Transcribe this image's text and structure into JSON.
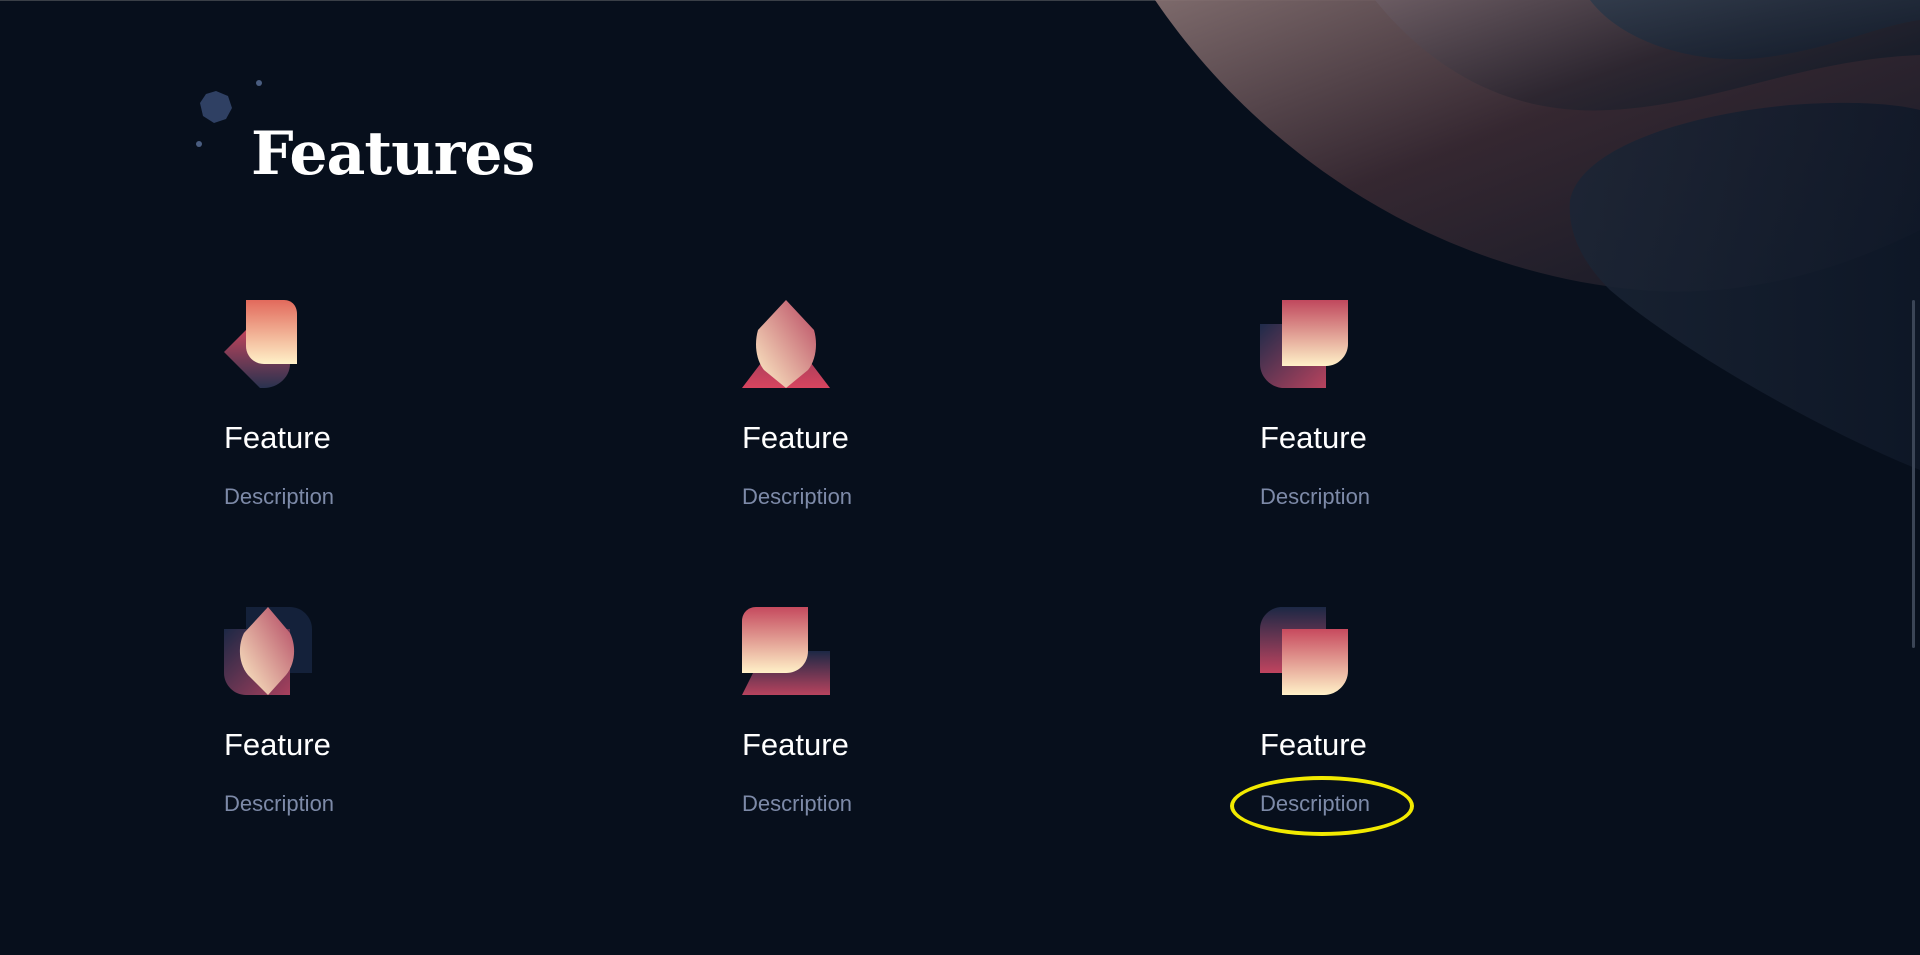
{
  "page": {
    "title": "Features"
  },
  "features": [
    {
      "title": "Feature",
      "description": "Description",
      "icon": "abstract-shape-1-icon"
    },
    {
      "title": "Feature",
      "description": "Description",
      "icon": "abstract-shape-2-icon"
    },
    {
      "title": "Feature",
      "description": "Description",
      "icon": "abstract-shape-3-icon"
    },
    {
      "title": "Feature",
      "description": "Description",
      "icon": "abstract-shape-4-icon"
    },
    {
      "title": "Feature",
      "description": "Description",
      "icon": "abstract-shape-5-icon"
    },
    {
      "title": "Feature",
      "description": "Description",
      "icon": "abstract-shape-6-icon"
    }
  ],
  "colors": {
    "background": "#070f1c",
    "title": "#ffffff",
    "feature_title": "#ffffff",
    "description": "#7d8aa8",
    "highlight": "#f2ea00"
  }
}
